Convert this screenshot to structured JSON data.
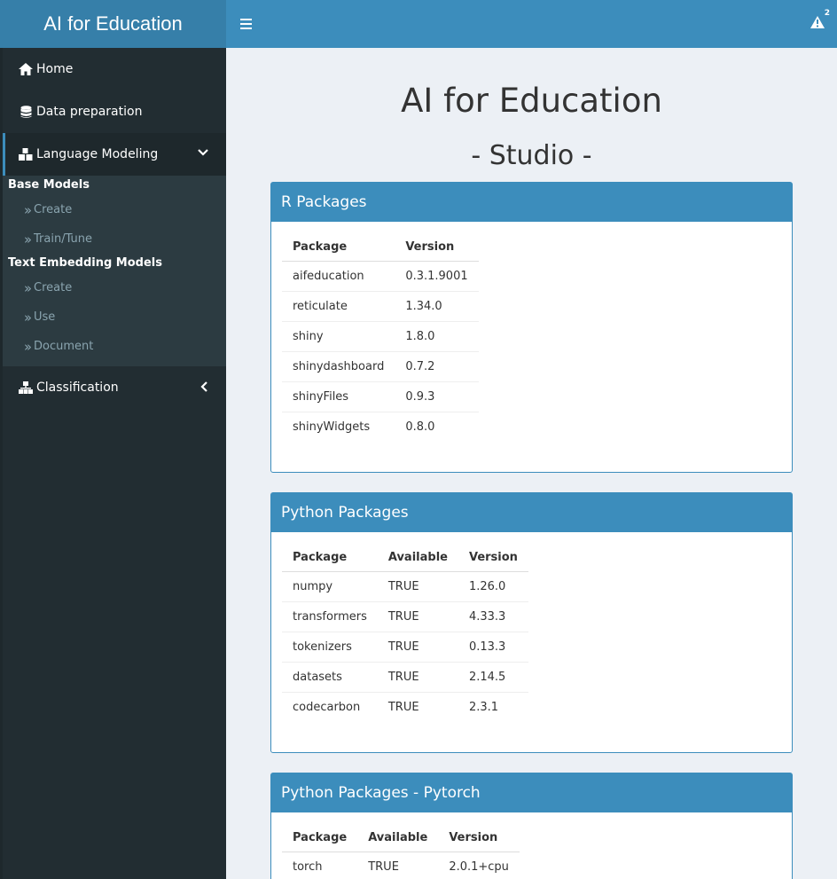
{
  "header": {
    "logo": "AI for Education",
    "notification_count": "2"
  },
  "sidebar": {
    "items": [
      {
        "label": "Home",
        "icon": "home-icon"
      },
      {
        "label": "Data preparation",
        "icon": "database-icon"
      },
      {
        "label": "Language Modeling",
        "icon": "cubes-icon",
        "expanded": true
      },
      {
        "label": "Classification",
        "icon": "sitemap-icon",
        "expanded": false
      }
    ],
    "language_modeling": {
      "base_models": {
        "heading": "Base Models",
        "items": [
          "Create",
          "Train/Tune"
        ]
      },
      "text_embedding": {
        "heading": "Text Embedding Models",
        "items": [
          "Create",
          "Use",
          "Document"
        ]
      }
    }
  },
  "main": {
    "title": "AI for Education",
    "subtitle": "- Studio -",
    "r_packages": {
      "heading": "R Packages",
      "columns": [
        "Package",
        "Version"
      ],
      "rows": [
        [
          "aifeducation",
          "0.3.1.9001"
        ],
        [
          "reticulate",
          "1.34.0"
        ],
        [
          "shiny",
          "1.8.0"
        ],
        [
          "shinydashboard",
          "0.7.2"
        ],
        [
          "shinyFiles",
          "0.9.3"
        ],
        [
          "shinyWidgets",
          "0.8.0"
        ]
      ]
    },
    "python_packages": {
      "heading": "Python Packages",
      "columns": [
        "Package",
        "Available",
        "Version"
      ],
      "rows": [
        [
          "numpy",
          "TRUE",
          "1.26.0"
        ],
        [
          "transformers",
          "TRUE",
          "4.33.3"
        ],
        [
          "tokenizers",
          "TRUE",
          "0.13.3"
        ],
        [
          "datasets",
          "TRUE",
          "2.14.5"
        ],
        [
          "codecarbon",
          "TRUE",
          "2.3.1"
        ]
      ]
    },
    "pytorch_packages": {
      "heading": "Python Packages - Pytorch",
      "columns": [
        "Package",
        "Available",
        "Version"
      ],
      "rows": [
        [
          "torch",
          "TRUE",
          "2.0.1+cpu"
        ]
      ]
    }
  }
}
